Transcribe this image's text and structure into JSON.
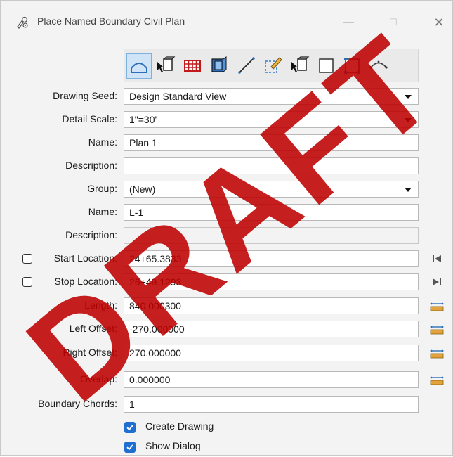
{
  "window": {
    "title": "Place Named Boundary Civil Plan",
    "minimize_glyph": "—",
    "maximize_glyph": "☐",
    "close_glyph": "✕"
  },
  "toolbar": {
    "tools": [
      "civil-plan-icon",
      "arrow-cube-icon",
      "grid-icon",
      "3d-volume-icon",
      "line-icon",
      "dashed-square-pen-icon",
      "arrow-cube-icon",
      "square-icon",
      "corner-square-icon",
      "civil-profile-icon"
    ],
    "active_index": 0
  },
  "form": {
    "drawing_seed": {
      "label": "Drawing Seed:",
      "value": "Design Standard View"
    },
    "detail_scale": {
      "label": "Detail Scale:",
      "value": "1\"=30'"
    },
    "name": {
      "label": "Name:",
      "value": "Plan 1"
    },
    "description": {
      "label": "Description:",
      "value": ""
    },
    "group": {
      "label": "Group:",
      "value": "(New)"
    },
    "name2": {
      "label": "Name:",
      "value": "L-1"
    },
    "description2": {
      "label": "Description:",
      "value": ""
    },
    "start_location": {
      "label": "Start Location:",
      "value": "24+65.3833",
      "checked": false
    },
    "stop_location": {
      "label": "Stop Location:",
      "value": "26+49.1293",
      "checked": false
    },
    "length": {
      "label": "Length:",
      "value": "840.000300"
    },
    "left_offset": {
      "label": "Left Offset:",
      "value": "-270.000000"
    },
    "right_offset": {
      "label": "Right Offset:",
      "value": "270.000000"
    },
    "overlap": {
      "label": "Overlap:",
      "value": "0.000000"
    },
    "boundary_chords": {
      "label": "Boundary Chords:",
      "value": "1"
    },
    "create_drawing": {
      "label": "Create Drawing",
      "checked": true
    },
    "show_dialog": {
      "label": "Show Dialog",
      "checked": true
    }
  },
  "watermark": "DRAFT",
  "colors": {
    "accent": "#1f6fd1",
    "watermark": "#c00000",
    "active_tool": "#cfe4f7"
  }
}
